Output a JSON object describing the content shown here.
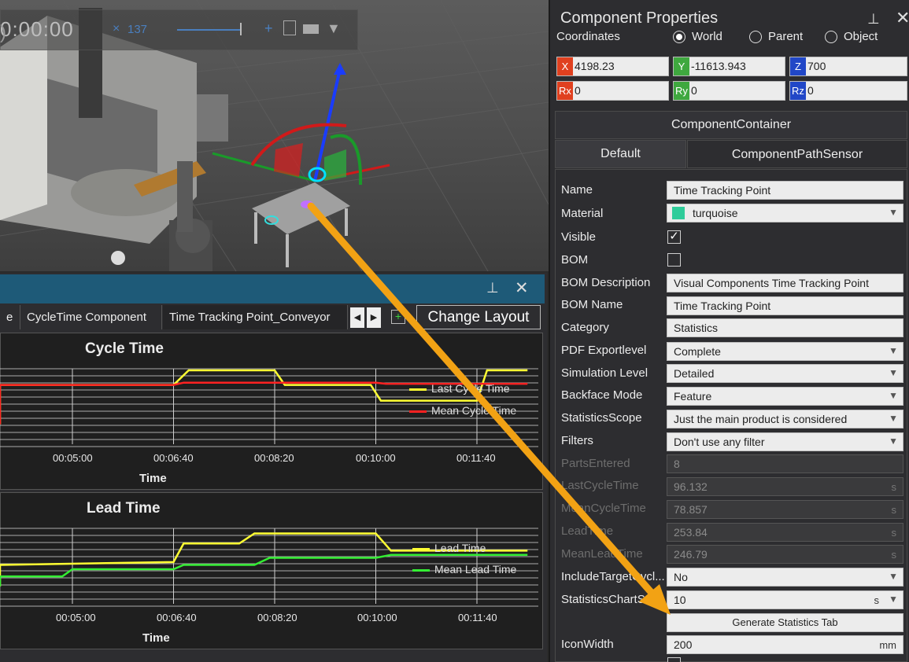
{
  "viewport": {
    "time": "0:00:00",
    "counter": "137"
  },
  "properties": {
    "title": "Component Properties",
    "coordinates_label": "Coordinates",
    "coord_modes": [
      "World",
      "Parent",
      "Object"
    ],
    "coord_mode_selected": "World",
    "x": {
      "tag": "X",
      "value": "4198.23",
      "color": "#e0401f"
    },
    "y": {
      "tag": "Y",
      "value": "-11613.943",
      "color": "#3fa83f"
    },
    "z": {
      "tag": "Z",
      "value": "700",
      "color": "#2147c7"
    },
    "rx": {
      "tag": "Rx",
      "value": "0",
      "color": "#e0401f"
    },
    "ry": {
      "tag": "Ry",
      "value": "0",
      "color": "#3fa83f"
    },
    "rz": {
      "tag": "Rz",
      "value": "0",
      "color": "#2147c7"
    },
    "container": "ComponentContainer",
    "tabs": [
      "Default",
      "ComponentPathSensor"
    ],
    "rows": {
      "name": {
        "label": "Name",
        "value": "Time Tracking Point"
      },
      "material": {
        "label": "Material",
        "value": "turquoise",
        "swatch": "#2ecc9a"
      },
      "visible": {
        "label": "Visible",
        "checked": true
      },
      "bom": {
        "label": "BOM",
        "checked": false
      },
      "bom_description": {
        "label": "BOM Description",
        "value": "Visual Components Time Tracking Point"
      },
      "bom_name": {
        "label": "BOM Name",
        "value": "Time Tracking Point"
      },
      "category": {
        "label": "Category",
        "value": "Statistics"
      },
      "pdf_exportlevel": {
        "label": "PDF Exportlevel",
        "value": "Complete"
      },
      "simulation_level": {
        "label": "Simulation Level",
        "value": "Detailed"
      },
      "backface_mode": {
        "label": "Backface Mode",
        "value": "Feature"
      },
      "statistics_scope": {
        "label": "StatisticsScope",
        "value": "Just the main product is considered"
      },
      "filters": {
        "label": "Filters",
        "value": "Don't use any filter"
      },
      "parts_entered": {
        "label": "PartsEntered",
        "value": "8"
      },
      "last_cycle_time": {
        "label": "LastCycleTime",
        "value": "96.132",
        "unit": "s"
      },
      "mean_cycle_time": {
        "label": "MeanCycleTime",
        "value": "78.857",
        "unit": "s"
      },
      "lead_time": {
        "label": "LeadTime",
        "value": "253.84",
        "unit": "s"
      },
      "mean_lead_time": {
        "label": "MeanLeadTime",
        "value": "246.79",
        "unit": "s"
      },
      "include_target": {
        "label": "IncludeTargetCycl...",
        "value": "No"
      },
      "statistics_chart": {
        "label": "StatisticsChartSa...",
        "value": "10",
        "unit": "s"
      },
      "generate_button": "Generate Statistics Tab",
      "icon_width": {
        "label": "IconWidth",
        "value": "200",
        "unit": "mm"
      }
    }
  },
  "chart_panel": {
    "tabs": [
      "e",
      "CycleTime Component",
      "Time Tracking Point_Conveyor"
    ],
    "change_layout": "Change Layout"
  },
  "chart_data": [
    {
      "type": "line",
      "title": "Cycle Time",
      "xlabel": "Time",
      "x_ticks": [
        "00:05:00",
        "00:06:40",
        "00:08:20",
        "00:10:00",
        "00:11:40"
      ],
      "series": [
        {
          "name": "Last Cycle Time",
          "color": "#ffff33",
          "x": [
            "00:03:30",
            "00:03:40",
            "00:06:40",
            "00:06:55",
            "00:08:20",
            "00:08:30",
            "00:09:55",
            "00:10:05",
            "00:11:40",
            "00:11:50",
            "00:12:30"
          ],
          "y": [
            55,
            90,
            90,
            103,
            103,
            90,
            90,
            76,
            76,
            103,
            103
          ]
        },
        {
          "name": "Mean Cycle Time",
          "color": "#ff2222",
          "x": [
            "00:03:30",
            "00:03:40",
            "00:06:40",
            "00:06:50",
            "00:10:00",
            "00:10:10",
            "00:12:30"
          ],
          "y": [
            55,
            90,
            90,
            92,
            92,
            91,
            91
          ]
        }
      ]
    },
    {
      "type": "line",
      "title": "Lead Time",
      "xlabel": "Time",
      "x_ticks": [
        "00:05:00",
        "00:06:40",
        "00:08:20",
        "00:10:00",
        "00:11:40"
      ],
      "series": [
        {
          "name": "Lead Time",
          "color": "#ffff33",
          "x": [
            "00:03:30",
            "00:03:40",
            "00:06:40",
            "00:06:50",
            "00:07:45",
            "00:08:00",
            "00:10:00",
            "00:10:15",
            "00:12:30"
          ],
          "y": [
            225,
            240,
            242,
            255,
            255,
            262,
            262,
            250,
            250
          ]
        },
        {
          "name": "Mean Lead Time",
          "color": "#33ee33",
          "x": [
            "00:03:30",
            "00:03:40",
            "00:04:50",
            "00:05:00",
            "00:06:40",
            "00:06:50",
            "00:08:00",
            "00:08:15",
            "00:10:00",
            "00:10:15",
            "00:12:30"
          ],
          "y": [
            225,
            232,
            232,
            237,
            237,
            240,
            240,
            245,
            245,
            247,
            247
          ]
        }
      ]
    }
  ]
}
